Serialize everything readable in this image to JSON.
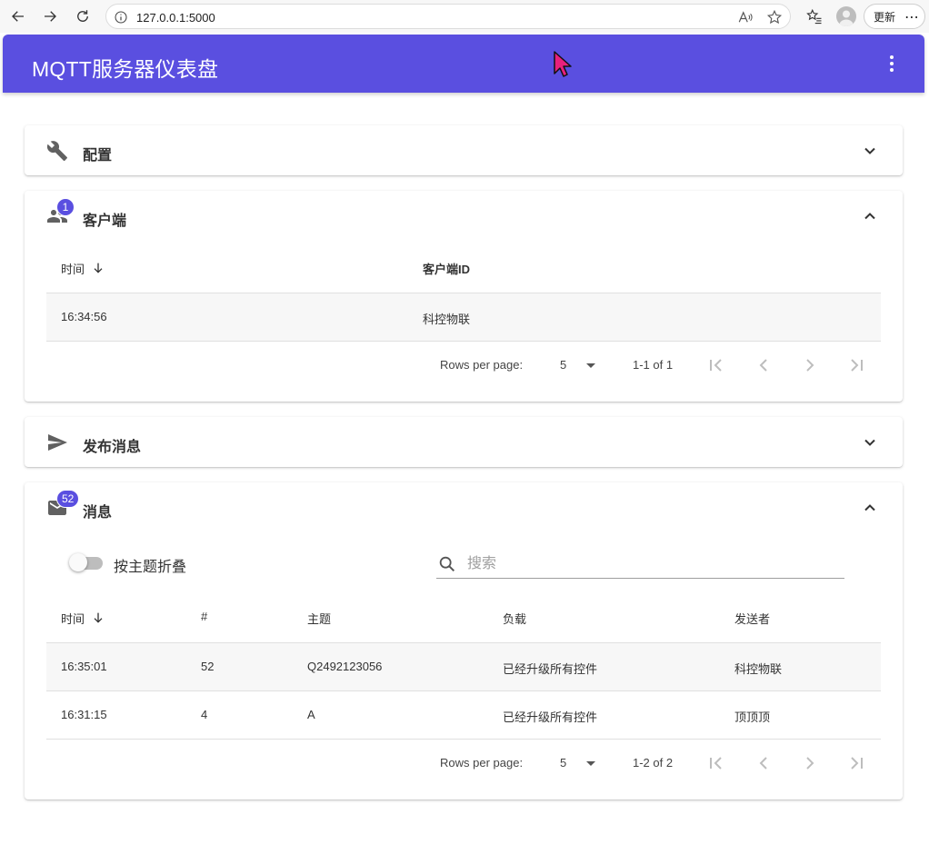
{
  "browser": {
    "url": "127.0.0.1:5000",
    "update_label": "更新"
  },
  "app": {
    "title": "MQTT服务器仪表盘",
    "accent_color": "#5a4fe0"
  },
  "panels": {
    "config": {
      "title": "配置",
      "icon": "wrench-icon",
      "expanded": false
    },
    "clients": {
      "title": "客户端",
      "icon": "people-icon",
      "badge": "1",
      "expanded": true,
      "columns": [
        "时间",
        "客户端ID"
      ],
      "rows": [
        {
          "time": "16:34:56",
          "client_id": "科控物联"
        }
      ],
      "pager": {
        "rows_label": "Rows per page:",
        "rows_value": "5",
        "range": "1-1 of 1"
      }
    },
    "publish": {
      "title": "发布消息",
      "icon": "send-icon",
      "expanded": false
    },
    "messages": {
      "title": "消息",
      "icon": "mail-icon",
      "badge": "52",
      "expanded": true,
      "toggle_label": "按主题折叠",
      "search_placeholder": "搜索",
      "columns": [
        "时间",
        "#",
        "主题",
        "负载",
        "发送者"
      ],
      "rows": [
        {
          "time": "16:35:01",
          "num": "52",
          "topic": "Q2492123056",
          "payload": "已经升级所有控件",
          "sender": "科控物联"
        },
        {
          "time": "16:31:15",
          "num": "4",
          "topic": "A",
          "payload": "已经升级所有控件",
          "sender": "顶顶顶"
        }
      ],
      "pager": {
        "rows_label": "Rows per page:",
        "rows_value": "5",
        "range": "1-2 of 2"
      }
    }
  }
}
